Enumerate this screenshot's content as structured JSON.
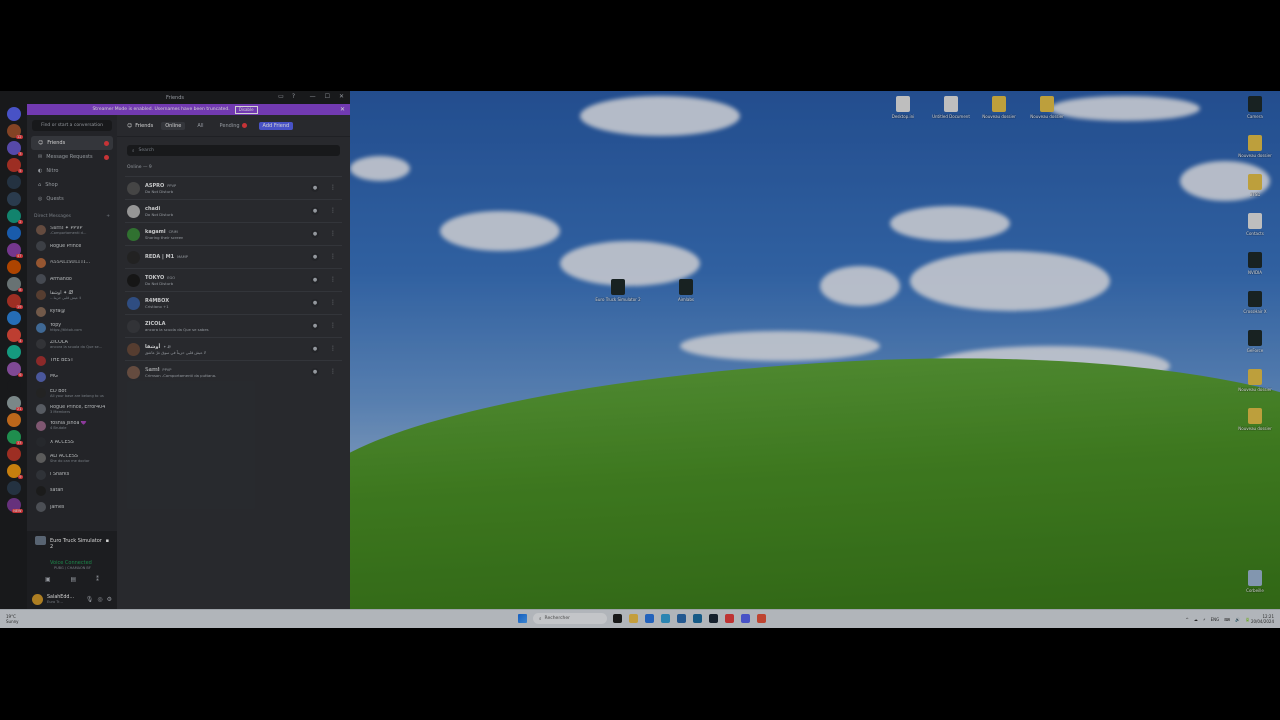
{
  "window": {
    "title": "Friends",
    "title_icons": [
      "inbox-icon",
      "help-icon"
    ],
    "controls": [
      "—",
      "☐",
      "✕"
    ]
  },
  "banner": {
    "text": "Streamer Mode is enabled. Usernames have been truncated.",
    "button": "Disable",
    "close": "✕"
  },
  "guilds": [
    {
      "color": "#5865f2",
      "badge": ""
    },
    {
      "color": "#a0522d",
      "badge": "12"
    },
    {
      "color": "#6a5acd",
      "badge": "3"
    },
    {
      "color": "#c0392b",
      "badge": "5"
    },
    {
      "color": "#2c3e50",
      "badge": ""
    },
    {
      "color": "#34495e",
      "badge": ""
    },
    {
      "color": "#16a085",
      "badge": "2"
    },
    {
      "color": "#1f6fd1",
      "badge": ""
    },
    {
      "color": "#8e44ad",
      "badge": "47"
    },
    {
      "color": "#d35400",
      "badge": ""
    },
    {
      "color": "#7f8c8d",
      "badge": "8"
    },
    {
      "color": "#c0392b",
      "badge": "19"
    },
    {
      "color": "#2e86de",
      "badge": ""
    },
    {
      "color": "#e74c3c",
      "badge": "4"
    },
    {
      "color": "#1abc9c",
      "badge": ""
    },
    {
      "color": "#9b59b6",
      "badge": "6"
    },
    {
      "color": "#1e1f22",
      "badge": ""
    },
    {
      "color": "#95a5a6",
      "badge": "21"
    },
    {
      "color": "#e67e22",
      "badge": ""
    },
    {
      "color": "#27ae60",
      "badge": "33"
    },
    {
      "color": "#c0392b",
      "badge": ""
    },
    {
      "color": "#f39c12",
      "badge": "9"
    },
    {
      "color": "#2c3e50",
      "badge": ""
    },
    {
      "color": "#7d3c98",
      "badge": "NEW"
    }
  ],
  "sidebar": {
    "find": "Find or start a conversation",
    "nav": [
      {
        "label": "Friends",
        "icon": "friends-icon",
        "active": true,
        "dot": true
      },
      {
        "label": "Message Requests",
        "icon": "mail-icon",
        "active": false,
        "dot": true
      },
      {
        "label": "Nitro",
        "icon": "nitro-icon",
        "active": false,
        "dot": false
      },
      {
        "label": "Shop",
        "icon": "shop-icon",
        "active": false,
        "dot": false
      },
      {
        "label": "Quests",
        "icon": "quests-icon",
        "active": false,
        "dot": false
      }
    ],
    "dm_header": "Direct Messages",
    "dm_add": "+",
    "dms": [
      {
        "name": "𝕊𝕒𝕞𝕚 ✦ PPVP",
        "status": "-Comportamenti d…",
        "color": "#7a5c4d"
      },
      {
        "name": "Rogue Prince",
        "status": "",
        "color": "#4a4d55"
      },
      {
        "name": "𝔸𝕊𝕊𝔸𝕃𝕀𝕊𝕆𝕃𝕀𝕋𝕀…",
        "status": "",
        "color": "#b86a3c"
      },
      {
        "name": "Armando",
        "status": "",
        "color": "#555a63"
      },
      {
        "name": "أوشقا ✦ Ꮺ",
        "status": "…لا عيش قلبي حزيناً",
        "color": "#6a4b3b"
      },
      {
        "name": "kyra@",
        "status": "",
        "color": "#8a6d5a"
      },
      {
        "name": "Yopy",
        "status": "https://tiktok.com",
        "color": "#4e7fb5"
      },
      {
        "name": "ZICOLA",
        "status": "ancora la scuola da Que se…",
        "color": "#3e3f44"
      },
      {
        "name": "THE BEST",
        "status": "",
        "color": "#a33"
      },
      {
        "name": "MG",
        "status": "",
        "color": "#5b6bbf"
      },
      {
        "name": "ED Bot",
        "status": "All your base are belong to us",
        "color": "#2b2b2b"
      },
      {
        "name": "Rogue Prince, Error404",
        "status": "3 Members",
        "color": "#6b6f78"
      },
      {
        "name": "Yoshia Jshoa 💜",
        "status": "4 Brutale",
        "color": "#9c6b8a"
      },
      {
        "name": "X ACCESS",
        "status": "",
        "color": "#2f3136"
      },
      {
        "name": "ALI ACCESS",
        "status": "She do can me doctor",
        "color": "#707070"
      },
      {
        "name": "I Sharks",
        "status": "",
        "color": "#3a3d44"
      },
      {
        "name": "satan",
        "status": "",
        "color": "#222"
      },
      {
        "name": "james",
        "status": "",
        "color": "#5d6168"
      }
    ]
  },
  "game": {
    "title": "Euro Truck Simulator 2",
    "voice_label": "Voice Connected",
    "voice_sub": "PUBG / CHAMAON BF",
    "buttons": [
      "camera-icon",
      "screen-share-icon",
      "activity-icon"
    ]
  },
  "user": {
    "name": "SalahEdd…",
    "status": "Euro Tr…",
    "controls": [
      "mic-icon",
      "headphones-icon",
      "settings-icon"
    ]
  },
  "friends_page": {
    "header_label": "Friends",
    "tabs": [
      {
        "label": "Online",
        "selected": true
      },
      {
        "label": "All",
        "selected": false
      },
      {
        "label": "Pending",
        "selected": false,
        "dot": true
      },
      {
        "label": "Add Friend",
        "add": true
      }
    ],
    "search_placeholder": "Search",
    "online_header": "Online — 9",
    "friends": [
      {
        "name": "ASPRO",
        "tag": "PPVP",
        "status": "Do Not Disturb",
        "color": "#555"
      },
      {
        "name": "chadi",
        "tag": "",
        "status": "Do Not Disturb",
        "color": "#b8b8b8"
      },
      {
        "name": "kagami",
        "tag": "CRIM",
        "status": "Sharing their screen",
        "color": "#3b8a3b"
      },
      {
        "name": "REDA | M1",
        "tag": "MAMP",
        "status": "",
        "color": "#2a2a2a"
      },
      {
        "name": "TOKYO",
        "tag": "EGO",
        "status": "Do Not Disturb",
        "color": "#1b1b1b"
      },
      {
        "name": "R4MBOX",
        "tag": "",
        "status": "Cristiano +1",
        "color": "#3a5f9e"
      },
      {
        "name": "ZICOLA",
        "tag": "",
        "status": "ancora la scuola da Que se sabes",
        "color": "#3e3f44"
      },
      {
        "name": "أوشقا",
        "tag": "✦ Ꮺ",
        "status": "لا عيش قلبي حزيناً في سوق غرّ عاشق",
        "color": "#6a4b3b"
      },
      {
        "name": "𝕊𝕒𝕞𝕚",
        "tag": "PPVP",
        "status": "Crimson -Comportamenti da puttana-",
        "color": "#7a5c4d"
      }
    ]
  },
  "desktop": {
    "icons_top": [
      {
        "label": "Desktop.ini",
        "type": "file"
      },
      {
        "label": "Untitled Document",
        "type": "file"
      },
      {
        "label": "Nouveau dossier",
        "type": "folder"
      },
      {
        "label": "Nouveau dossier",
        "type": "folder"
      }
    ],
    "icons_right": [
      {
        "label": "Camera",
        "type": "app"
      },
      {
        "label": "Nouveau dossier",
        "type": "folder"
      },
      {
        "label": "BTSD",
        "type": "folder"
      },
      {
        "label": "Contacts",
        "type": "file"
      },
      {
        "label": "NVIDIA",
        "type": "app"
      },
      {
        "label": "CrossHair X",
        "type": "app"
      },
      {
        "label": "GeForce",
        "type": "app"
      },
      {
        "label": "Nouveau dossier",
        "type": "folder"
      },
      {
        "label": "Nouveau dossier",
        "type": "folder"
      },
      {
        "label": "Corbeille",
        "type": "bin"
      }
    ],
    "icons_center": [
      {
        "label": "Euro Truck Simulator 2",
        "type": "app"
      },
      {
        "label": "Aimlabs",
        "type": "app"
      }
    ]
  },
  "taskbar": {
    "weather": "19°C",
    "weather_sub": "Sunny",
    "search_placeholder": "Rechercher",
    "apps": [
      "#1e1e1e",
      "#f0c14b",
      "#2b78e4",
      "#36a3d9",
      "#2b6cb0",
      "#1c6ea4",
      "#1b2838",
      "#e83f3f",
      "#5865f2",
      "#e8543c"
    ],
    "clock_time": "12:21",
    "clock_date": "20/04/2024",
    "tray": [
      "^",
      "☁",
      "⚡",
      "ENG",
      "⌨",
      "🔊",
      "🔋"
    ]
  }
}
